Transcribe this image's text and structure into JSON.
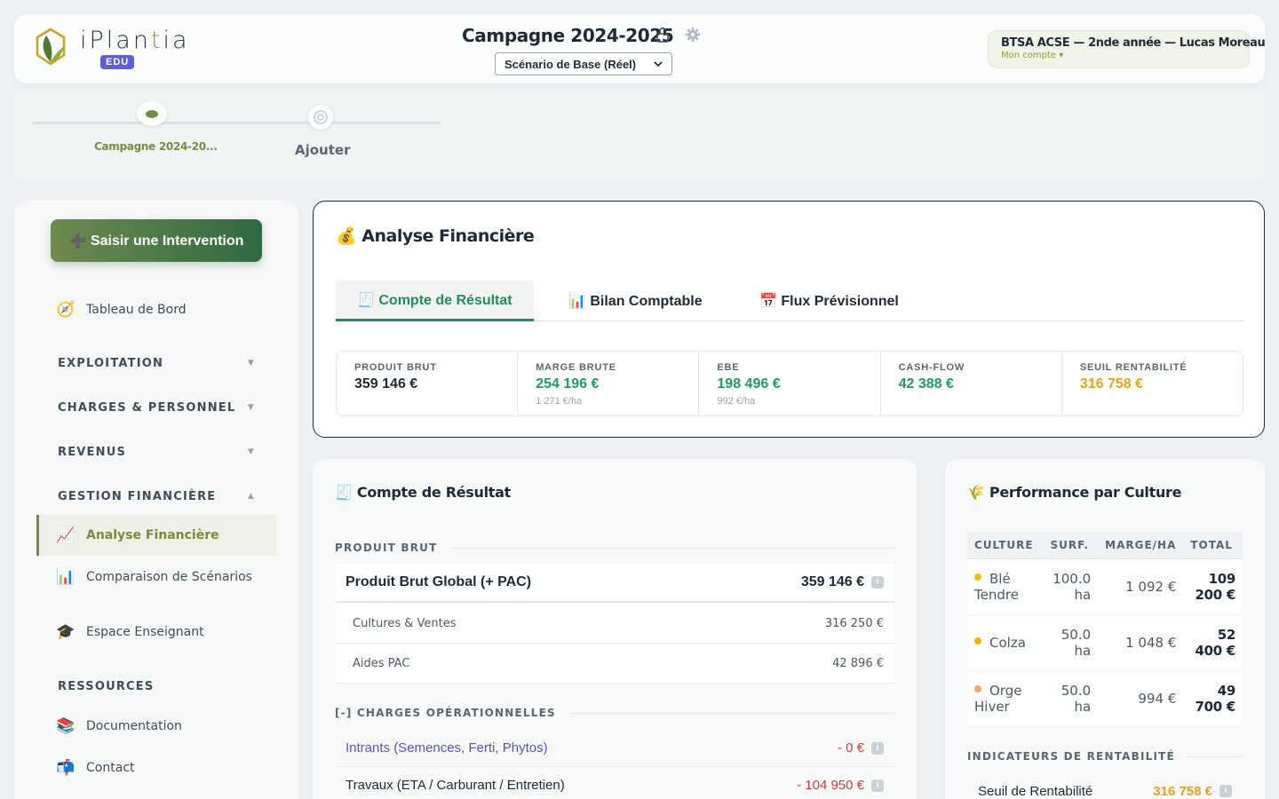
{
  "header": {
    "logo_text_prefix": "iPlan",
    "logo_text_accent": "t",
    "logo_text_suffix": "ia",
    "badge": "EDU",
    "campaign_title": "Campagne 2024-2025",
    "scenario_selected": "Scénario de Base (Réel)",
    "account_name": "BTSA ACSE — 2nde année — Lucas Moreau",
    "account_link": "Mon compte ▾"
  },
  "timeline": {
    "active_label": "Campagne 2024-20...",
    "add_label": "Ajouter"
  },
  "sidebar": {
    "cta": "➕ Saisir une Intervention",
    "items": {
      "dashboard": {
        "icon": "🧭",
        "label": "Tableau de Bord"
      },
      "analyse": {
        "icon": "📈",
        "label": "Analyse Financière"
      },
      "comparaison": {
        "icon": "📊",
        "label": "Comparaison de Scénarios"
      },
      "enseignant": {
        "icon": "🎓",
        "label": "Espace Enseignant"
      },
      "documentation": {
        "icon": "📚",
        "label": "Documentation"
      },
      "contact": {
        "icon": "📬",
        "label": "Contact"
      }
    },
    "sections": {
      "exploitation": "EXPLOITATION",
      "charges": "CHARGES & PERSONNEL",
      "revenus": "REVENUS",
      "gestion": "GESTION FINANCIÈRE",
      "ressources": "RESSOURCES"
    }
  },
  "analyse": {
    "title": "💰 Analyse Financière",
    "tabs": {
      "compte": "🧾 Compte de Résultat",
      "bilan": "📊 Bilan Comptable",
      "flux": "📅 Flux Prévisionnel"
    },
    "kpis": [
      {
        "label": "Produit Brut",
        "value": "359 146 €",
        "sub": "",
        "color": "#1e2a36"
      },
      {
        "label": "Marge Brute",
        "value": "254 196 €",
        "sub": "1 271 €/ha",
        "color": "#1e9a62"
      },
      {
        "label": "EBE",
        "value": "198 496 €",
        "sub": "992 €/ha",
        "color": "#1e9a62"
      },
      {
        "label": "Cash-Flow",
        "value": "42 388 €",
        "sub": "",
        "color": "#1e9a62"
      },
      {
        "label": "Seuil Rentabilité",
        "value": "316 758 €",
        "sub": "",
        "color": "#e8a21a"
      }
    ]
  },
  "compte_resultat": {
    "title": "🧾 Compte de Résultat",
    "produit_brut_head": "PRODUIT BRUT",
    "produit_global_label": "Produit Brut Global (+ PAC)",
    "produit_global_value": "359 146 €",
    "cultures_label": "Cultures & Ventes",
    "cultures_value": "316 250 €",
    "aides_label": "Aides PAC",
    "aides_value": "42 896 €",
    "charges_head": "[-] CHARGES OPÉRATIONNELLES",
    "intrants_label": "Intrants (Semences, Ferti, Phytos)",
    "intrants_value": "- 0 €",
    "travaux_label": "Travaux (ETA / Carburant / Entretien)",
    "travaux_value": "- 104 950 €"
  },
  "performance": {
    "title": "🌾 Performance par Culture",
    "columns": [
      "CULTURE",
      "SURF.",
      "MARGE/HA",
      "TOTAL"
    ],
    "rows": [
      {
        "culture": "Blé Tendre",
        "surf": "100.0 ha",
        "marge": "1 092 €",
        "total": "109 200 €",
        "color": "#e8c21a"
      },
      {
        "culture": "Colza",
        "surf": "50.0 ha",
        "marge": "1 048 €",
        "total": "52 400 €",
        "color": "#e8b21a"
      },
      {
        "culture": "Orge Hiver",
        "surf": "50.0 ha",
        "marge": "994 €",
        "total": "49 700 €",
        "color": "#f2a86a"
      }
    ],
    "indic_head": "INDICATEURS DE RENTABILITÉ",
    "seuil_label": "Seuil de Rentabilité",
    "seuil_value": "316 758 €"
  }
}
